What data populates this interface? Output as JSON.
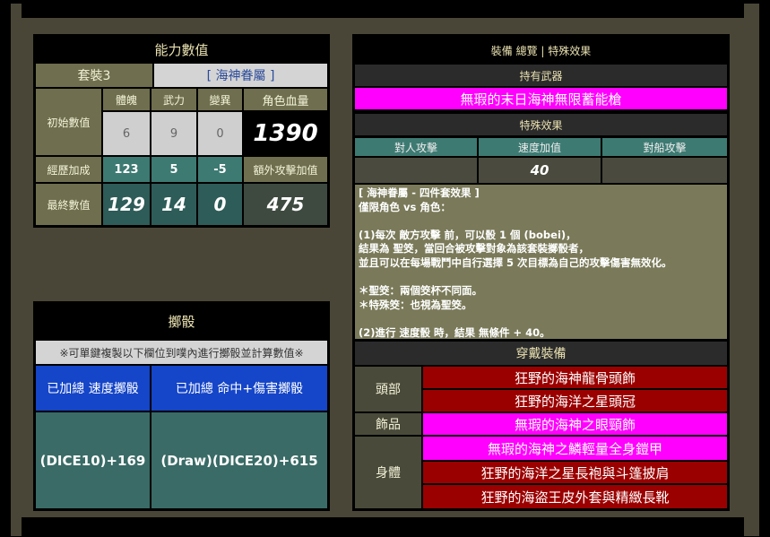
{
  "stats": {
    "title": "能力數值",
    "set_label": "套裝3",
    "set_name": "[ 海神眷屬 ]",
    "headers": {
      "body": "體魄",
      "force": "武力",
      "mutation": "變異",
      "hp": "角色血量"
    },
    "initial": {
      "label": "初始數值",
      "body": "6",
      "force": "9",
      "mutation": "0",
      "hp": "1390"
    },
    "exp": {
      "label": "經歷加成",
      "body": "123",
      "force": "5",
      "mutation": "-5",
      "extra_label": "額外攻擊加值"
    },
    "final": {
      "label": "最終數值",
      "body": "129",
      "force": "14",
      "mutation": "0",
      "extra": "475"
    }
  },
  "dice": {
    "title": "擲骰",
    "note": "※可單鍵複製以下欄位到噗內進行擲骰並計算數值※",
    "speed_header": "已加總 速度擲骰",
    "hit_header": "已加總 命中+傷害擲骰",
    "speed_value": "(DICE10)+169",
    "hit_value": "(Draw)(DICE20)+615"
  },
  "equip": {
    "title": "裝備 總覽 | 特殊效果",
    "weapon_label": "持有武器",
    "weapon": "無瑕的末日海神無限蓄能槍",
    "special_label": "特殊效果",
    "cols": {
      "person": "對人攻擊",
      "speed": "速度加值",
      "ship": "對船攻擊"
    },
    "vals": {
      "person": "",
      "speed": "40",
      "ship": ""
    },
    "effect_lines": [
      "[ 海神眷屬 - 四件套效果 ]",
      "僅限角色 vs 角色：",
      "",
      "(1)每次 敵方攻擊 前，可以骰 1 個 (bobei)，",
      "結果為 聖筊，當回合被攻擊對象為該套裝擲骰者，",
      "並且可以在每場戰鬥中自行選擇 5 次目標為自己的攻擊傷害無效化。",
      "",
      "＊聖筊：兩個筊杯不同面。",
      "＊特殊筊：也視為聖筊。",
      "",
      "(2)進行 速度骰 時，結果 無條件 + 40。"
    ],
    "wear_label": "穿戴裝備",
    "head_label": "頭部",
    "head_items": [
      "狂野的海神龍骨頭飾",
      "狂野的海洋之星頭冠"
    ],
    "acc_label": "飾品",
    "acc_items": [
      "無瑕的海神之眼頸飾"
    ],
    "body_label": "身體",
    "body_items": [
      "無瑕的海神之鱗輕量全身鎧甲",
      "狂野的海洋之星長袍與斗篷披肩",
      "狂野的海盜王皮外套與精緻長靴"
    ]
  },
  "colors": {
    "magenta": "#ff00ff",
    "red": "#9b0000",
    "teal": "#3d7a72",
    "olive": "#7a7a5a"
  }
}
